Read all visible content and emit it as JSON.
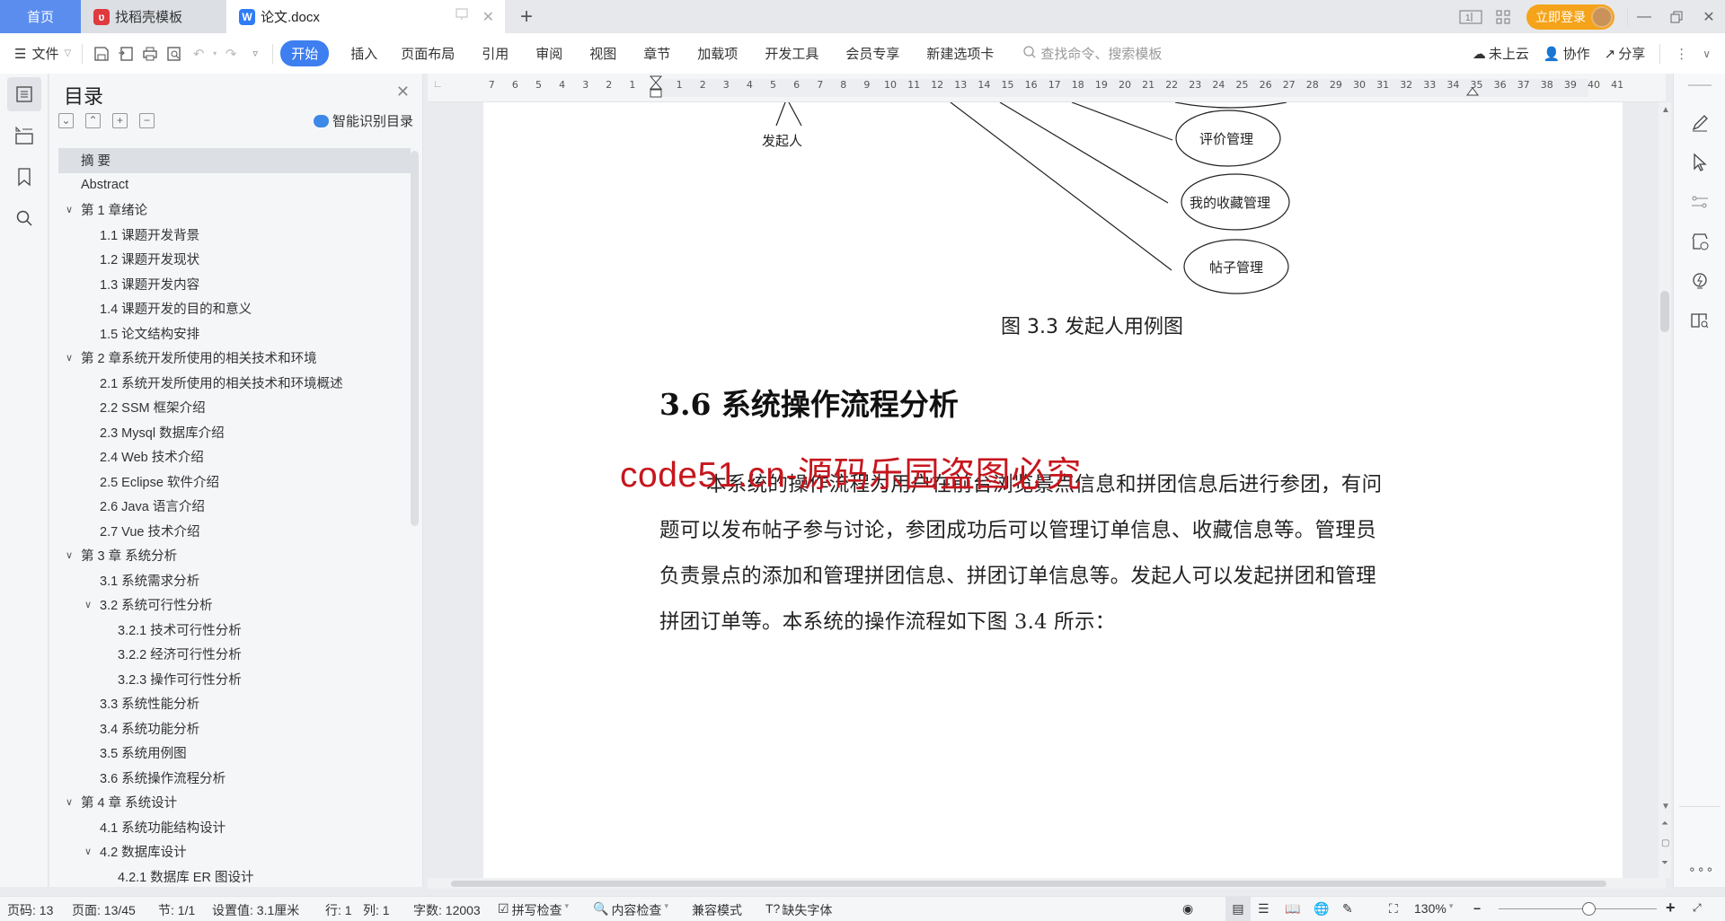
{
  "titlebar": {
    "tabs": [
      {
        "label": "首页",
        "active": false
      },
      {
        "label": "找稻壳模板",
        "active": false
      },
      {
        "label": "论文.docx",
        "active": true
      }
    ],
    "login_label": "立即登录"
  },
  "menubar": {
    "file_label": "文件",
    "tabs": [
      "开始",
      "插入",
      "页面布局",
      "引用",
      "审阅",
      "视图",
      "章节",
      "加载项",
      "开发工具",
      "会员专享",
      "新建选项卡"
    ],
    "search_placeholder": "查找命令、搜索模板",
    "cloud_label": "未上云",
    "collab_label": "协作",
    "share_label": "分享"
  },
  "ruler": {
    "left_ticks": [
      "7",
      "6",
      "5",
      "4",
      "3",
      "2",
      "1"
    ],
    "right_ticks": [
      "1",
      "2",
      "3",
      "4",
      "5",
      "6",
      "7",
      "8",
      "9",
      "10",
      "11",
      "12",
      "13",
      "14",
      "15",
      "16",
      "17",
      "18",
      "19",
      "20",
      "21",
      "22",
      "23",
      "24",
      "25",
      "26",
      "27",
      "28",
      "29",
      "30",
      "31",
      "32",
      "33",
      "34",
      "35",
      "36",
      "37",
      "38",
      "39",
      "40",
      "41"
    ]
  },
  "toc": {
    "title": "目录",
    "smart_label": "智能识别目录",
    "items": [
      {
        "label": "摘  要",
        "level": 0,
        "chevron": false,
        "selected": true
      },
      {
        "label": "Abstract",
        "level": 0,
        "chevron": false
      },
      {
        "label": "第 1 章绪论",
        "level": 0,
        "chevron": true
      },
      {
        "label": "1.1 课题开发背景",
        "level": 1,
        "chevron": false
      },
      {
        "label": "1.2 课题开发现状",
        "level": 1,
        "chevron": false
      },
      {
        "label": "1.3 课题开发内容",
        "level": 1,
        "chevron": false
      },
      {
        "label": "1.4 课题开发的目的和意义",
        "level": 1,
        "chevron": false
      },
      {
        "label": "1.5 论文结构安排",
        "level": 1,
        "chevron": false
      },
      {
        "label": "第 2 章系统开发所使用的相关技术和环境",
        "level": 0,
        "chevron": true
      },
      {
        "label": "2.1 系统开发所使用的相关技术和环境概述",
        "level": 1,
        "chevron": false
      },
      {
        "label": "2.2 SSM 框架介绍",
        "level": 1,
        "chevron": false
      },
      {
        "label": "2.3 Mysql 数据库介绍",
        "level": 1,
        "chevron": false
      },
      {
        "label": "2.4 Web 技术介绍",
        "level": 1,
        "chevron": false
      },
      {
        "label": "2.5 Eclipse 软件介绍",
        "level": 1,
        "chevron": false
      },
      {
        "label": "2.6 Java 语言介绍",
        "level": 1,
        "chevron": false
      },
      {
        "label": "2.7 Vue 技术介绍",
        "level": 1,
        "chevron": false
      },
      {
        "label": "第 3 章  系统分析",
        "level": 0,
        "chevron": true
      },
      {
        "label": "3.1 系统需求分析",
        "level": 1,
        "chevron": false
      },
      {
        "label": "3.2 系统可行性分析",
        "level": 1,
        "chevron": true
      },
      {
        "label": "3.2.1 技术可行性分析",
        "level": 2,
        "chevron": false
      },
      {
        "label": "3.2.2 经济可行性分析",
        "level": 2,
        "chevron": false
      },
      {
        "label": "3.2.3 操作可行性分析",
        "level": 2,
        "chevron": false
      },
      {
        "label": "3.3 系统性能分析",
        "level": 1,
        "chevron": false
      },
      {
        "label": "3.4  系统功能分析",
        "level": 1,
        "chevron": false
      },
      {
        "label": "3.5 系统用例图",
        "level": 1,
        "chevron": false
      },
      {
        "label": "3.6 系统操作流程分析",
        "level": 1,
        "chevron": false
      },
      {
        "label": "第 4 章  系统设计",
        "level": 0,
        "chevron": true
      },
      {
        "label": "4.1 系统功能结构设计",
        "level": 1,
        "chevron": false
      },
      {
        "label": "4.2 数据库设计",
        "level": 1,
        "chevron": true
      },
      {
        "label": "4.2.1 数据库 ER 图设计",
        "level": 2,
        "chevron": false
      }
    ]
  },
  "document": {
    "diagram": {
      "actor_label": "发起人",
      "use_cases": [
        "评价管理",
        "我的收藏管理",
        "帖子管理"
      ]
    },
    "caption": "图 3.3 发起人用例图",
    "heading": "3.6 系统操作流程分析",
    "paragraph_lines": [
      "本系统的操作流程为用户在前台浏览景点信息和拼团信息后进行参团，有问",
      "题可以发布帖子参与讨论，参团成功后可以管理订单信息、收藏信息等。管理员",
      "负责景点的添加和管理拼团信息、拼团订单信息等。发起人可以发起拼团和管理",
      "拼团订单等。本系统的操作流程如下图 3.4 所示："
    ],
    "watermark": "code51.cn-源码乐园盗图必究"
  },
  "statusbar": {
    "page_num": "页码: 13",
    "pages": "页面: 13/45",
    "section": "节: 1/1",
    "setting": "设置值: 3.1厘米",
    "row": "行: 1",
    "col": "列: 1",
    "word_count": "字数: 12003",
    "spell_check": "拼写检查",
    "content_check": "内容检查",
    "compat_mode": "兼容模式",
    "missing_fonts": "缺失字体",
    "zoom": "130%",
    "zoom_slider_fraction": 0.57
  }
}
